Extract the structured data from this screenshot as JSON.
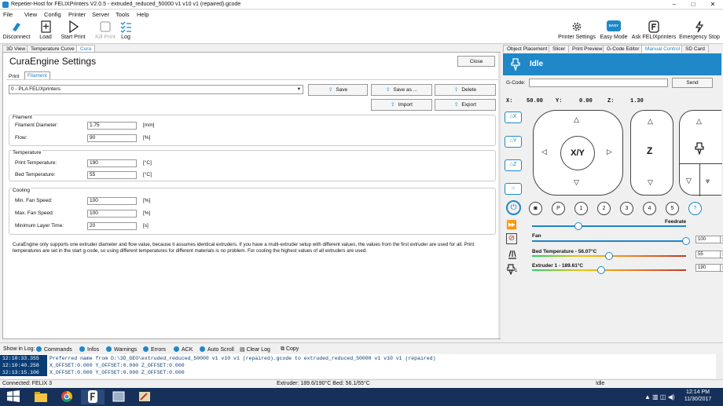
{
  "window": {
    "title": "Repetier-Host for FELIXPrinters V2.0.5 - extruded_reduced_50000 v1 v10 v1 (repaired).gcode",
    "minimize": "–",
    "maximize": "□",
    "close": "✕"
  },
  "menu": [
    "File",
    "View",
    "Config",
    "Printer",
    "Server",
    "Tools",
    "Help"
  ],
  "toolbar": {
    "disconnect": "Disconnect",
    "load": "Load",
    "start_print": "Start Print",
    "kill_print": "Kill Print",
    "log": "Log",
    "printer_settings": "Printer Settings",
    "easy_mode": "Easy Mode",
    "easy_badge": "EASY",
    "ask_felix": "Ask FELIXprinters",
    "emergency_stop": "Emergency Stop"
  },
  "left_tabs": [
    "3D View",
    "Temperature Curve",
    "Cura"
  ],
  "right_tabs": [
    "Object Placement",
    "Slicer",
    "Print Preview",
    "G-Code Editor",
    "Manual Control",
    "SD Card"
  ],
  "cura": {
    "title": "CuraEngine Settings",
    "close": "Close",
    "subtabs": [
      "Print",
      "Filament"
    ],
    "profile": "0 - PLA FELIXprinters",
    "buttons": {
      "save": "Save",
      "save_as": "Save as ...",
      "delete": "Delete",
      "import": "Import",
      "export": "Export"
    },
    "filament": {
      "title": "Filament",
      "diameter_label": "Filament Diameter:",
      "diameter": "1.75",
      "diameter_unit": "[mm]",
      "flow_label": "Flow:",
      "flow": "90",
      "flow_unit": "[%]"
    },
    "temperature": {
      "title": "Temperature",
      "print_label": "Print Temperature:",
      "print": "190",
      "print_unit": "[°C]",
      "bed_label": "Bed Temperature:",
      "bed": "55",
      "bed_unit": "[°C]"
    },
    "cooling": {
      "title": "Cooling",
      "min_fan_label": "Min. Fan Speed:",
      "min_fan": "100",
      "min_fan_unit": "[%]",
      "max_fan_label": "Max. Fan Speed:",
      "max_fan": "100",
      "max_fan_unit": "[%]",
      "min_layer_label": "Minimum Layer Time:",
      "min_layer": "20",
      "min_layer_unit": "[s]"
    },
    "note": "CuraEngine only supports one extruder diameter and flow value, because it assumes identical extruders. If you have a multi-extruder setup with different values, the values from the first extruder are used for all. Print temperatures are set in the start g-code, so using different temperatures for different materials is no problem. For cooling the highest values of all extruders are used."
  },
  "manual": {
    "status": "Idle",
    "gcode_label": "G-Code:",
    "send": "Send",
    "x_label": "X:",
    "x": "50.00",
    "y_label": "Y:",
    "y": "0.00",
    "z_label": "Z:",
    "z": "1.30",
    "home_x": "X",
    "home_y": "Y",
    "home_z": "Z",
    "xy": "X/Y",
    "z_center": "Z",
    "buttons": [
      "P",
      "1",
      "2",
      "3",
      "4",
      "5",
      "?"
    ],
    "feedrate_label": "Feedrate",
    "feedrate": "100",
    "fan_label": "Fan",
    "fan": "100",
    "bed_label": "Bed Temperature - 56.07°C",
    "bed": "55",
    "extruder_label": "Extruder 1 - 189.61°C",
    "extruder": "190",
    "extruder_num": "1",
    "feedrate_level": 0.3,
    "fan_level": 1.0,
    "bed_level": 0.5,
    "extruder_level": 0.45
  },
  "log": {
    "show_label": "Show in Log:",
    "options": [
      "Commands",
      "Infos",
      "Warnings",
      "Errors",
      "ACK",
      "Auto Scroll"
    ],
    "clear": "Clear Log",
    "copy": "Copy",
    "rows": [
      {
        "time": "12:10:33.355",
        "msg": "Preferred name from D:\\3D_GEO\\extruded_reduced_50000 v1 v10 v1 (repaired).gcode to extruded_reduced_50000 v1 v10 v1 (repaired)"
      },
      {
        "time": "12:10:40.258",
        "msg": "X_OFFSET:0.000 Y_OFFSET:0.000 Z_OFFSET:0.000"
      },
      {
        "time": "12:13:15.106",
        "msg": "X_OFFSET:0.000 Y_OFFSET:0.000 Z_OFFSET:0.000"
      }
    ]
  },
  "status": {
    "connected": "Connected: FELIX 3",
    "temps": "Extruder: 189.6/190°C Bed: 56.1/55°C",
    "state": "Idle"
  },
  "taskbar": {
    "time": "12:14 PM",
    "date": "11/30/2017"
  },
  "colors": {
    "accent": "#1e88c8",
    "log_bg": "#0b3d75",
    "taskbar": "#16305a"
  }
}
